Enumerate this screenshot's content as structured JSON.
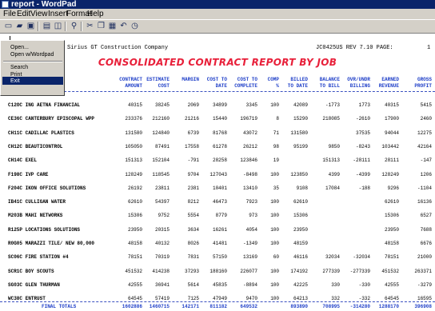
{
  "window": {
    "title": "report - WordPad"
  },
  "menubar": [
    "File",
    "Edit",
    "View",
    "Insert",
    "Format",
    "Help"
  ],
  "toolbar": {
    "icons": [
      "new-icon",
      "open-icon",
      "save-icon",
      "print-icon",
      "print-preview-icon",
      "find-icon",
      "cut-icon",
      "copy-icon",
      "paste-icon",
      "undo-icon",
      "date-time-icon"
    ]
  },
  "report": {
    "company": "Sirius GT Construction Company",
    "report_id": "JC0425US REV 7.10 PAGE:",
    "page_no": "1",
    "title": "CONSOLIDATED CONTRACT REPORT BY JOB",
    "columns": [
      [
        "CONTRACT",
        "AMOUNT"
      ],
      [
        "ESTIMATE",
        "COST"
      ],
      [
        "MARGIN",
        ""
      ],
      [
        "COST TO",
        "DATE"
      ],
      [
        "COST TO",
        "COMPLETE"
      ],
      [
        "COMP",
        "%"
      ],
      [
        "BILLED",
        "TO DATE"
      ],
      [
        "BALANCE",
        "TO BILL"
      ],
      [
        "OVR/UNDR",
        "BILLING"
      ],
      [
        "EARNED",
        "REVENUE"
      ],
      [
        "GROSS",
        "PROFIT"
      ]
    ],
    "rows": [
      [
        "C12OC ING AETNA FINANCIAL",
        "40315",
        "38245",
        "2069",
        "34899",
        "3345",
        "100",
        "42089",
        "-1773",
        "1773",
        "40315",
        "5415"
      ],
      [
        "CE36C CANTERBURY EPISCOPAL WPP",
        "233376",
        "212160",
        "21216",
        "15440",
        "196719",
        "8",
        "15290",
        "218085",
        "-2610",
        "17900",
        "2460"
      ],
      [
        "CH11C CADILLAC PLASTICS",
        "131580",
        "124840",
        "6739",
        "81768",
        "43072",
        "71",
        "131580",
        "",
        "37535",
        "94044",
        "12275"
      ],
      [
        "CH12C BEAUTICONTROL",
        "105050",
        "87491",
        "17558",
        "61278",
        "26212",
        "98",
        "95199",
        "9850",
        "-8243",
        "103442",
        "42164"
      ],
      [
        "CH14C EXEL",
        "151313",
        "152104",
        "-791",
        "28258",
        "123846",
        "19",
        "",
        "151313",
        "-28111",
        "28111",
        "-147"
      ],
      [
        "F198C IVP CARE",
        "128249",
        "118545",
        "9704",
        "127043",
        "-8498",
        "100",
        "123850",
        "4399",
        "-4399",
        "128249",
        "1206"
      ],
      [
        "F204C IKON OFFICE SOLUTIONS",
        "26192",
        "23811",
        "2381",
        "10401",
        "13410",
        "35",
        "9108",
        "17084",
        "-188",
        "9296",
        "-1104"
      ],
      [
        "IB41C CULLIGAN WATER",
        "62610",
        "54397",
        "8212",
        "46473",
        "7923",
        "100",
        "62610",
        "",
        "",
        "62610",
        "16136"
      ],
      [
        "M203B MAHI NETWORKS",
        "15306",
        "9752",
        "5554",
        "8779",
        "973",
        "100",
        "15306",
        "",
        "",
        "15306",
        "6527"
      ],
      [
        "R125P LOCATIONS SOLUTIONS",
        "23950",
        "20315",
        "3634",
        "16261",
        "4054",
        "100",
        "23950",
        "",
        "",
        "23950",
        "7688"
      ],
      [
        "R0G05 MARAZZI TILE/ NEW 80,000",
        "48158",
        "40132",
        "8026",
        "41481",
        "-1349",
        "100",
        "48159",
        "",
        "",
        "48158",
        "6676"
      ],
      [
        "SC06C FIRE STATION #4",
        "78151",
        "70319",
        "7831",
        "57150",
        "13169",
        "60",
        "46116",
        "32034",
        "-32034",
        "78151",
        "21000"
      ],
      [
        "SCR1C BOY SCOUTS",
        "451532",
        "414238",
        "37293",
        "188160",
        "226077",
        "100",
        "174192",
        "277339",
        "-277339",
        "451532",
        "263371"
      ],
      [
        "SG03C GLEN THURMAN",
        "42555",
        "36941",
        "5614",
        "45835",
        "-8894",
        "100",
        "42225",
        "330",
        "-330",
        "42555",
        "-3279"
      ],
      [
        "WC38C ENTRUST",
        "64545",
        "57419",
        "7125",
        "47949",
        "9470",
        "100",
        "64213",
        "332",
        "-332",
        "64545",
        "16595"
      ]
    ],
    "totals": [
      "FINAL TOTALS",
      "1602886",
      "1460715",
      "142171",
      "811182",
      "649532",
      "",
      "893890",
      "708995",
      "-314280",
      "1288170",
      "396908"
    ]
  },
  "file_menu": {
    "items": [
      "Open...",
      "Open w/Wordpad",
      "Search",
      "Print",
      "Exit"
    ],
    "highlighted": "Exit"
  },
  "colors": {
    "title_red": "#e8203a",
    "header_blue": "#1f3fc8",
    "titlebar": "#0a246a"
  }
}
